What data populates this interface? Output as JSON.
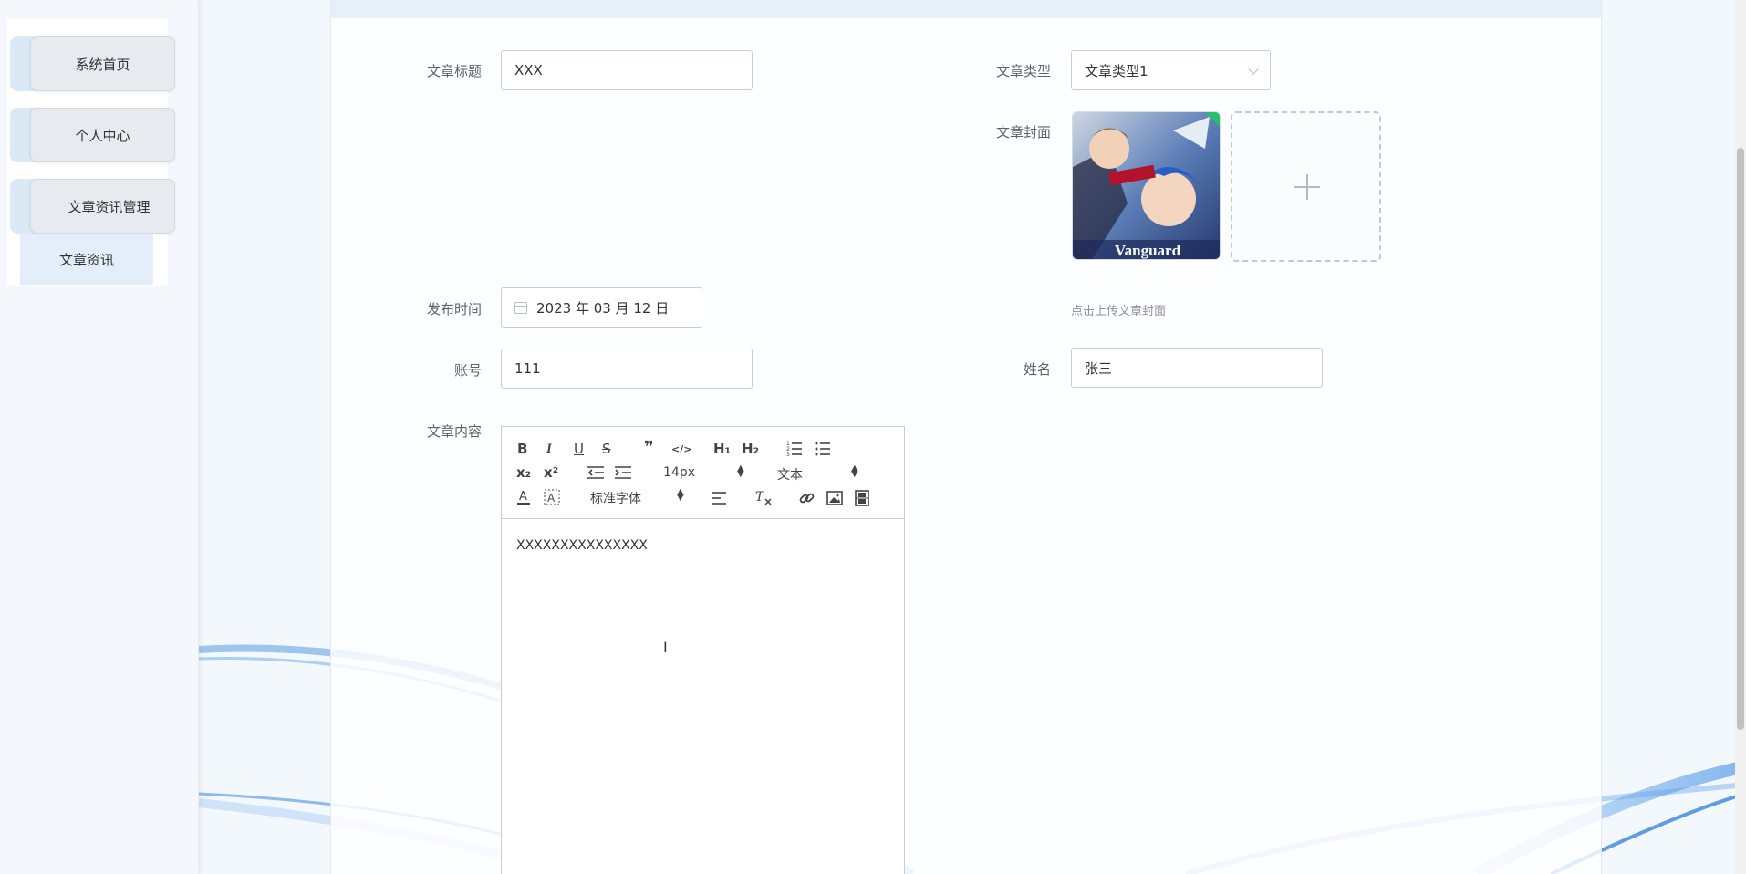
{
  "sidebar": {
    "items": [
      {
        "label": "系统首页"
      },
      {
        "label": "个人中心"
      },
      {
        "label": "文章资讯管理"
      }
    ],
    "submenu": {
      "label": "文章资讯"
    }
  },
  "form": {
    "title": {
      "label": "文章标题",
      "value": "XXX"
    },
    "type": {
      "label": "文章类型",
      "value": "文章类型1"
    },
    "cover": {
      "label": "文章封面",
      "image_text": "Vanguard",
      "upload_tip": "点击上传文章封面"
    },
    "publish_time": {
      "label": "发布时间",
      "value": "2023 年 03 月 12 日"
    },
    "account": {
      "label": "账号",
      "value": "111"
    },
    "name": {
      "label": "姓名",
      "value": "张三"
    },
    "content": {
      "label": "文章内容",
      "value": "XXXXXXXXXXXXXXX"
    }
  },
  "editor_toolbar": {
    "font_size": "14px",
    "header_select": "文本",
    "font_family": "标准字体",
    "bold": "B",
    "italic": "I",
    "underline": "U",
    "strike": "S",
    "blockquote": "❞",
    "code": "</>",
    "h1": "H₁",
    "h2": "H₂",
    "subscript": "x₂",
    "superscript": "x²"
  },
  "colors": {
    "accent": "#2d8cf0",
    "sidebar_bg": "#f4f8fc",
    "header_strip": "#e6f0fb"
  }
}
